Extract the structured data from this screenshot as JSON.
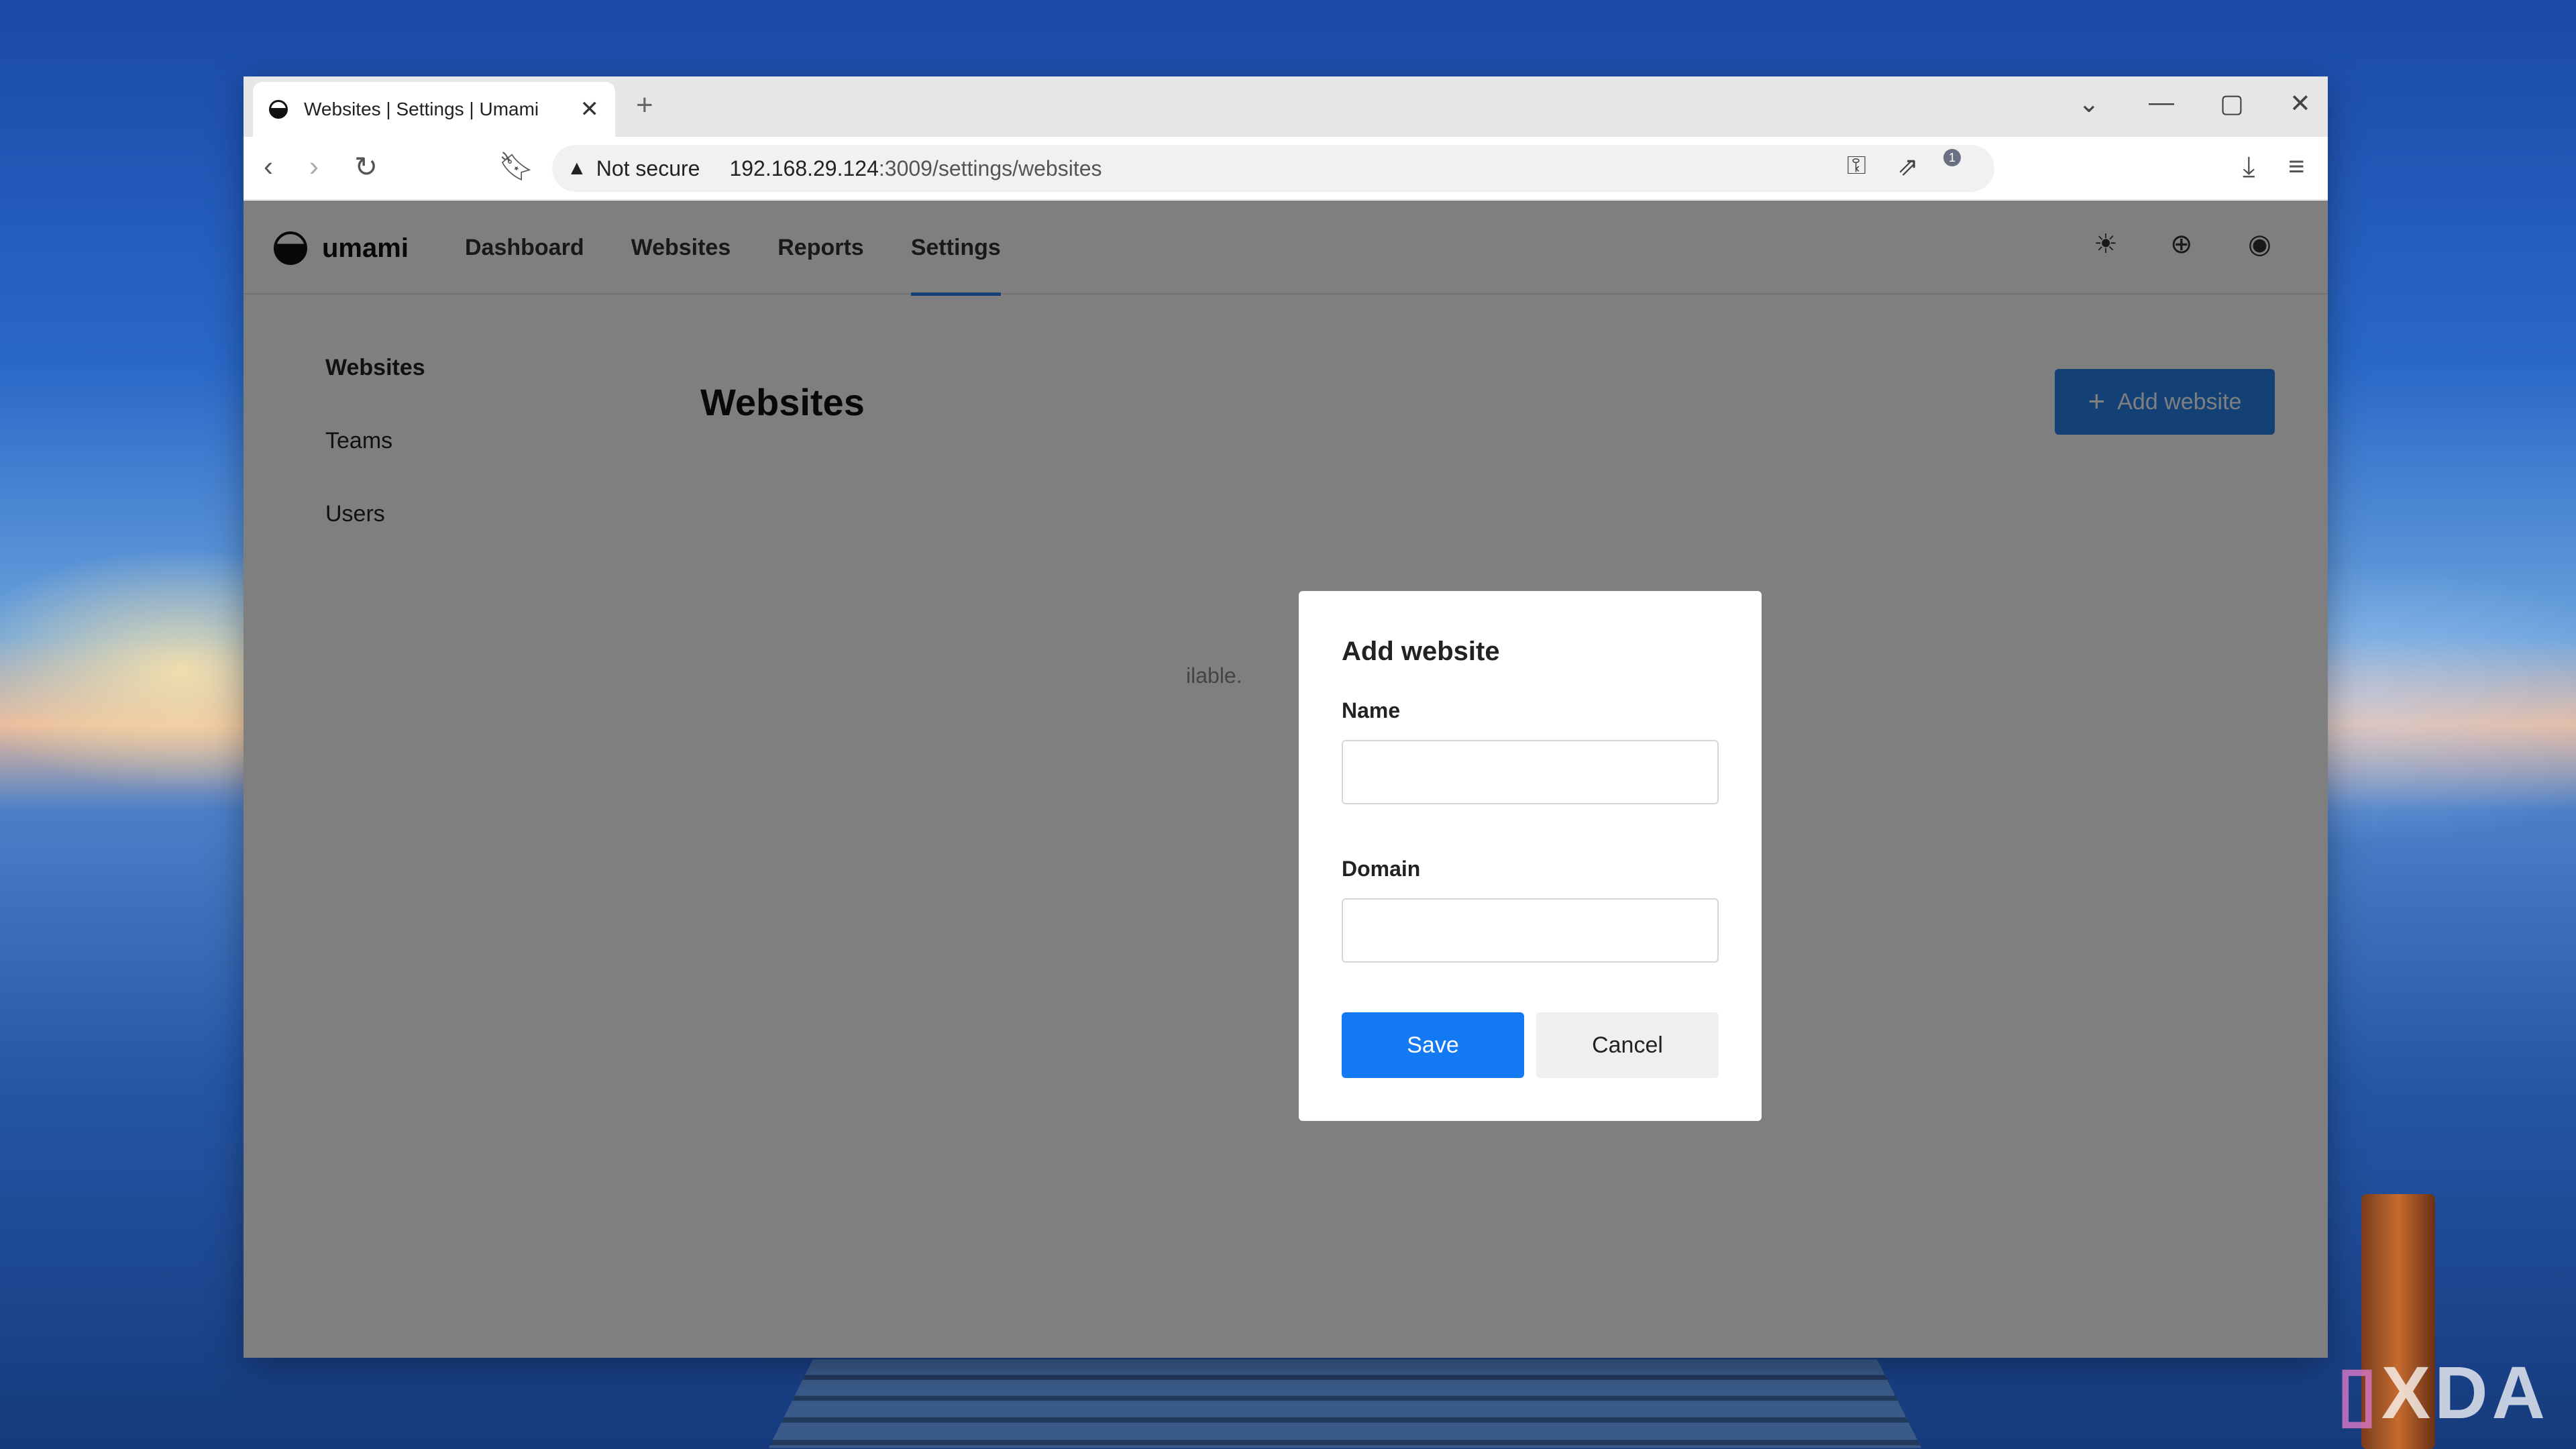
{
  "browser": {
    "tab_title": "Websites | Settings | Umami",
    "new_tab_symbol": "+",
    "security_label": "Not secure",
    "url_host": "192.168.29.124",
    "url_rest": ":3009/settings/websites",
    "extension_badge": "1"
  },
  "app": {
    "logo_text": "umami",
    "nav": [
      "Dashboard",
      "Websites",
      "Reports",
      "Settings"
    ],
    "active_nav": "Settings",
    "sidebar": [
      "Websites",
      "Teams",
      "Users"
    ],
    "page_title": "Websites",
    "add_button_label": "Add website",
    "empty_message_partial": "ilable."
  },
  "modal": {
    "title": "Add website",
    "name_label": "Name",
    "name_value": "",
    "domain_label": "Domain",
    "domain_value": "",
    "save_label": "Save",
    "cancel_label": "Cancel"
  },
  "colors": {
    "accent": "#2680eb",
    "save_button": "#147af3"
  },
  "icons": [
    "umami-logo-icon",
    "sun-icon",
    "globe-icon",
    "user-icon",
    "back-icon",
    "forward-icon",
    "reload-icon",
    "bookmark-icon",
    "warning-icon",
    "key-icon",
    "share-icon",
    "brave-icon",
    "download-icon",
    "menu-icon"
  ],
  "watermark": "XDA"
}
